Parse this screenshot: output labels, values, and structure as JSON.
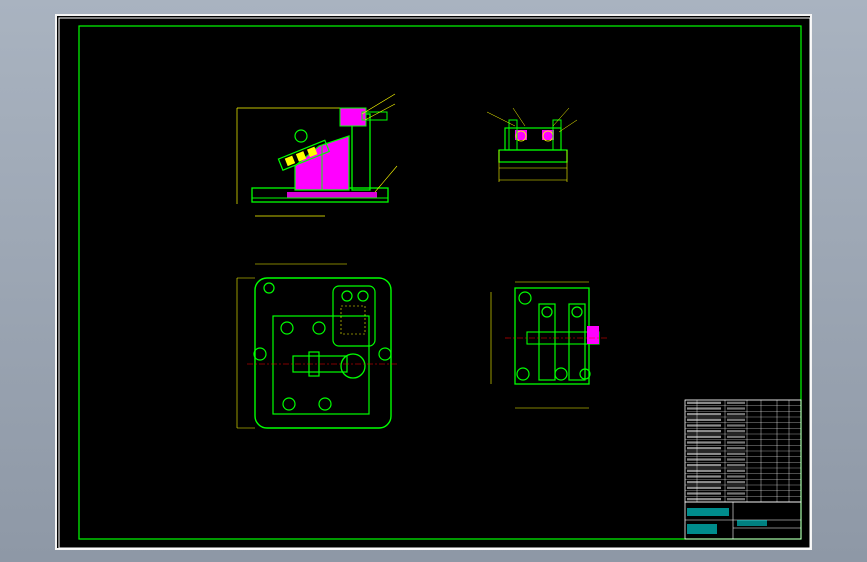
{
  "drawing": {
    "background": "#000000",
    "colors": {
      "frame": "#00ff00",
      "part": "#00ff00",
      "section": "#ff00ff",
      "dimension": "#ffff00",
      "text": "#ffff00",
      "centerline": "#ff0000",
      "title_text": "#00ffff",
      "table_line": "#ffffff"
    },
    "views": [
      {
        "name": "front-view",
        "label": ""
      },
      {
        "name": "side-view",
        "label": ""
      },
      {
        "name": "top-view",
        "label": ""
      },
      {
        "name": "base-view",
        "label": ""
      }
    ],
    "parts_list_rows": 18,
    "title_block": {
      "cells": []
    }
  }
}
